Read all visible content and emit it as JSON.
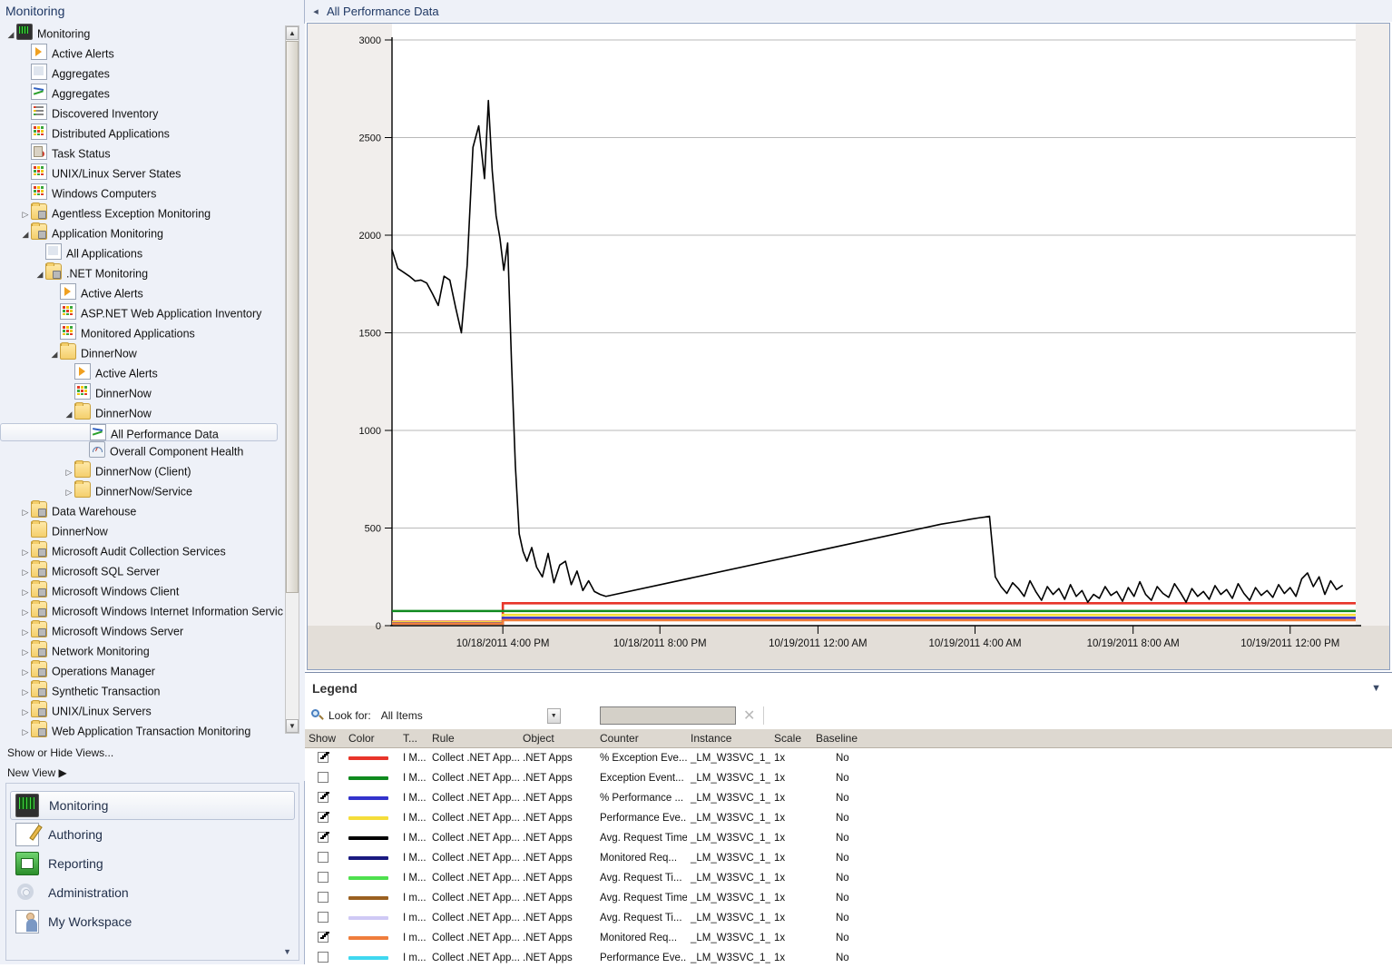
{
  "nav": {
    "header_title": "Monitoring",
    "collapse_icon": "chevron-left-icon",
    "tree": [
      {
        "depth": 0,
        "expander": "expanded",
        "icon": "monitor-icon",
        "label": "Monitoring"
      },
      {
        "depth": 1,
        "expander": "none",
        "icon": "alert-icon",
        "label": "Active Alerts"
      },
      {
        "depth": 1,
        "expander": "none",
        "icon": "report-icon",
        "label": "Aggregates"
      },
      {
        "depth": 1,
        "expander": "none",
        "icon": "chart-icon",
        "label": "Aggregates"
      },
      {
        "depth": 1,
        "expander": "none",
        "icon": "list-icon",
        "label": "Discovered Inventory"
      },
      {
        "depth": 1,
        "expander": "none",
        "icon": "grid-icon",
        "label": "Distributed Applications"
      },
      {
        "depth": 1,
        "expander": "none",
        "icon": "task-icon",
        "label": "Task Status"
      },
      {
        "depth": 1,
        "expander": "none",
        "icon": "grid-icon",
        "label": "UNIX/Linux Server States"
      },
      {
        "depth": 1,
        "expander": "none",
        "icon": "grid-icon",
        "label": "Windows Computers"
      },
      {
        "depth": 1,
        "expander": "collapsed",
        "icon": "folder-lock-icon",
        "label": "Agentless Exception Monitoring"
      },
      {
        "depth": 1,
        "expander": "expanded",
        "icon": "folder-lock-icon",
        "label": "Application Monitoring"
      },
      {
        "depth": 2,
        "expander": "none",
        "icon": "report-icon",
        "label": "All Applications"
      },
      {
        "depth": 2,
        "expander": "expanded",
        "icon": "folder-lock-icon",
        "label": ".NET Monitoring"
      },
      {
        "depth": 3,
        "expander": "none",
        "icon": "alert-icon",
        "label": "Active Alerts"
      },
      {
        "depth": 3,
        "expander": "none",
        "icon": "grid-icon",
        "label": "ASP.NET Web Application Inventory"
      },
      {
        "depth": 3,
        "expander": "none",
        "icon": "grid-icon",
        "label": "Monitored Applications"
      },
      {
        "depth": 3,
        "expander": "expanded",
        "icon": "folder-icon",
        "label": "DinnerNow"
      },
      {
        "depth": 4,
        "expander": "none",
        "icon": "alert-icon",
        "label": "Active Alerts"
      },
      {
        "depth": 4,
        "expander": "none",
        "icon": "grid-icon",
        "label": "DinnerNow"
      },
      {
        "depth": 4,
        "expander": "expanded",
        "icon": "folder-icon",
        "label": "DinnerNow"
      },
      {
        "depth": 5,
        "expander": "none",
        "icon": "chart-icon",
        "label": "All Performance Data",
        "selected": true
      },
      {
        "depth": 5,
        "expander": "none",
        "icon": "gauge-icon",
        "label": "Overall Component Health"
      },
      {
        "depth": 4,
        "expander": "collapsed",
        "icon": "folder-icon",
        "label": "DinnerNow (Client)"
      },
      {
        "depth": 4,
        "expander": "collapsed",
        "icon": "folder-icon",
        "label": "DinnerNow/Service"
      },
      {
        "depth": 1,
        "expander": "collapsed",
        "icon": "folder-lock-icon",
        "label": "Data Warehouse"
      },
      {
        "depth": 1,
        "expander": "none",
        "icon": "folder-icon",
        "label": "DinnerNow"
      },
      {
        "depth": 1,
        "expander": "collapsed",
        "icon": "folder-lock-icon",
        "label": "Microsoft Audit Collection Services"
      },
      {
        "depth": 1,
        "expander": "collapsed",
        "icon": "folder-lock-icon",
        "label": "Microsoft SQL Server"
      },
      {
        "depth": 1,
        "expander": "collapsed",
        "icon": "folder-lock-icon",
        "label": "Microsoft Windows Client"
      },
      {
        "depth": 1,
        "expander": "collapsed",
        "icon": "folder-lock-icon",
        "label": "Microsoft Windows Internet Information Services"
      },
      {
        "depth": 1,
        "expander": "collapsed",
        "icon": "folder-lock-icon",
        "label": "Microsoft Windows Server"
      },
      {
        "depth": 1,
        "expander": "collapsed",
        "icon": "folder-lock-icon",
        "label": "Network Monitoring"
      },
      {
        "depth": 1,
        "expander": "collapsed",
        "icon": "folder-lock-icon",
        "label": "Operations Manager"
      },
      {
        "depth": 1,
        "expander": "collapsed",
        "icon": "folder-lock-icon",
        "label": "Synthetic Transaction"
      },
      {
        "depth": 1,
        "expander": "collapsed",
        "icon": "folder-lock-icon",
        "label": "UNIX/Linux Servers"
      },
      {
        "depth": 1,
        "expander": "collapsed",
        "icon": "folder-lock-icon",
        "label": "Web Application Transaction Monitoring"
      }
    ],
    "links": [
      {
        "label": "Show or Hide Views..."
      },
      {
        "label": "New View ▶"
      }
    ],
    "buttons": [
      {
        "label": "Monitoring",
        "icon": "monitoring-icon",
        "active": true
      },
      {
        "label": "Authoring",
        "icon": "authoring-icon",
        "active": false
      },
      {
        "label": "Reporting",
        "icon": "reporting-icon",
        "active": false
      },
      {
        "label": "Administration",
        "icon": "administration-icon",
        "active": false
      },
      {
        "label": "My Workspace",
        "icon": "my-workspace-icon",
        "active": false
      }
    ],
    "more_icon": "chevron-down-icon"
  },
  "main": {
    "collapse_icon": "chevron-left-icon",
    "title": "All Performance Data"
  },
  "legend": {
    "title": "Legend",
    "collapse_icon": "chevron-down-icon",
    "search_icon": "search-icon",
    "lookfor_label": "Look for:",
    "lookfor_value": "All Items",
    "lookfor_arrow": "chevron-down-icon",
    "search_value": "",
    "search_placeholder": "",
    "clear_icon": "close-icon",
    "columns": [
      "Show",
      "Color",
      "T...",
      "Rule",
      "Object",
      "Counter",
      "Instance",
      "Scale",
      "Baseline"
    ],
    "rows": [
      {
        "show": true,
        "color": "#e8352a",
        "type": "I M...",
        "rule": "Collect .NET App...",
        "object": ".NET Apps",
        "counter": "% Exception Eve...",
        "instance": "_LM_W3SVC_1_...",
        "scale": "1x",
        "baseline": "No"
      },
      {
        "show": false,
        "color": "#0f8a1e",
        "type": "I M...",
        "rule": "Collect .NET App...",
        "object": ".NET Apps",
        "counter": "Exception Event...",
        "instance": "_LM_W3SVC_1_...",
        "scale": "1x",
        "baseline": "No"
      },
      {
        "show": true,
        "color": "#3333cc",
        "type": "I M...",
        "rule": "Collect .NET App...",
        "object": ".NET Apps",
        "counter": "% Performance ...",
        "instance": "_LM_W3SVC_1_...",
        "scale": "1x",
        "baseline": "No"
      },
      {
        "show": true,
        "color": "#f5dd3a",
        "type": "I M...",
        "rule": "Collect .NET App...",
        "object": ".NET Apps",
        "counter": "Performance Eve...",
        "instance": "_LM_W3SVC_1_...",
        "scale": "1x",
        "baseline": "No"
      },
      {
        "show": true,
        "color": "#000000",
        "type": "I M...",
        "rule": "Collect .NET App...",
        "object": ".NET Apps",
        "counter": "Avg. Request Time",
        "instance": "_LM_W3SVC_1_...",
        "scale": "1x",
        "baseline": "No"
      },
      {
        "show": false,
        "color": "#1a1a80",
        "type": "I M...",
        "rule": "Collect .NET App...",
        "object": ".NET Apps",
        "counter": "Monitored Req...",
        "instance": "_LM_W3SVC_1_...",
        "scale": "1x",
        "baseline": "No"
      },
      {
        "show": false,
        "color": "#4ee04e",
        "type": "I M...",
        "rule": "Collect .NET App...",
        "object": ".NET Apps",
        "counter": "Avg. Request Ti...",
        "instance": "_LM_W3SVC_1_...",
        "scale": "1x",
        "baseline": "No"
      },
      {
        "show": false,
        "color": "#9a6020",
        "type": "I m...",
        "rule": "Collect .NET App...",
        "object": ".NET Apps",
        "counter": "Avg. Request Time",
        "instance": "_LM_W3SVC_1_...",
        "scale": "1x",
        "baseline": "No"
      },
      {
        "show": false,
        "color": "#cfc9f5",
        "type": "I m...",
        "rule": "Collect .NET App...",
        "object": ".NET Apps",
        "counter": "Avg. Request Ti...",
        "instance": "_LM_W3SVC_1_...",
        "scale": "1x",
        "baseline": "No"
      },
      {
        "show": true,
        "color": "#ef7d3c",
        "type": "I m...",
        "rule": "Collect .NET App...",
        "object": ".NET Apps",
        "counter": "Monitored Req...",
        "instance": "_LM_W3SVC_1_...",
        "scale": "1x",
        "baseline": "No"
      },
      {
        "show": false,
        "color": "#3fd8f0",
        "type": "I m...",
        "rule": "Collect .NET App...",
        "object": ".NET Apps",
        "counter": "Performance Eve...",
        "instance": "_LM_W3SVC_1_...",
        "scale": "1x",
        "baseline": "No"
      }
    ]
  },
  "chart_data": {
    "type": "line",
    "title": "",
    "xlabel": "",
    "ylabel": "",
    "ylim": [
      0,
      3000
    ],
    "yticks": [
      0,
      500,
      1000,
      1500,
      2000,
      2500,
      3000
    ],
    "grid": true,
    "legend_position": "below",
    "xticks": [
      "10/18/2011 4:00 PM",
      "10/18/2011 8:00 PM",
      "10/19/2011 12:00 AM",
      "10/19/2011 4:00 AM",
      "10/19/2011 8:00 AM",
      "10/19/2011 12:00 PM"
    ],
    "xtick_positions": [
      0.115,
      0.278,
      0.442,
      0.605,
      0.769,
      0.932
    ],
    "series": [
      {
        "name": "Avg. Request Time",
        "color": "#000000",
        "x": [
          0.0,
          0.006,
          0.012,
          0.018,
          0.024,
          0.03,
          0.036,
          0.042,
          0.048,
          0.054,
          0.06,
          0.066,
          0.072,
          0.078,
          0.084,
          0.09,
          0.096,
          0.1,
          0.104,
          0.108,
          0.112,
          0.116,
          0.12,
          0.124,
          0.128,
          0.132,
          0.136,
          0.14,
          0.145,
          0.15,
          0.156,
          0.162,
          0.168,
          0.174,
          0.18,
          0.186,
          0.192,
          0.198,
          0.204,
          0.21,
          0.216,
          0.222,
          0.57,
          0.58,
          0.59,
          0.6,
          0.61,
          0.615,
          0.62,
          0.626,
          0.632,
          0.638,
          0.644,
          0.65,
          0.656,
          0.662,
          0.668,
          0.674,
          0.68,
          0.686,
          0.692,
          0.698,
          0.704,
          0.71,
          0.716,
          0.722,
          0.728,
          0.734,
          0.74,
          0.746,
          0.752,
          0.758,
          0.764,
          0.77,
          0.776,
          0.782,
          0.788,
          0.794,
          0.8,
          0.806,
          0.812,
          0.818,
          0.824,
          0.83,
          0.836,
          0.842,
          0.848,
          0.854,
          0.86,
          0.866,
          0.872,
          0.878,
          0.884,
          0.89,
          0.896,
          0.902,
          0.908,
          0.914,
          0.92,
          0.926,
          0.932,
          0.938,
          0.944,
          0.95,
          0.956,
          0.962,
          0.968,
          0.974,
          0.98,
          0.986,
          0.992,
          0.998
        ],
        "y": [
          1925,
          1830,
          1810,
          1790,
          1765,
          1770,
          1755,
          1700,
          1640,
          1790,
          1770,
          1630,
          1500,
          1845,
          2450,
          2560,
          2290,
          2690,
          2330,
          2100,
          1985,
          1820,
          1960,
          1350,
          820,
          470,
          380,
          330,
          400,
          300,
          250,
          370,
          220,
          310,
          330,
          210,
          280,
          180,
          230,
          175,
          160,
          150,
          520,
          528,
          536,
          545,
          553,
          556,
          560,
          250,
          200,
          165,
          220,
          190,
          150,
          230,
          175,
          130,
          200,
          160,
          190,
          135,
          210,
          150,
          180,
          120,
          160,
          140,
          200,
          155,
          175,
          125,
          195,
          150,
          225,
          160,
          130,
          200,
          165,
          145,
          215,
          170,
          120,
          190,
          150,
          175,
          135,
          205,
          160,
          185,
          140,
          215,
          165,
          130,
          195,
          155,
          180,
          145,
          210,
          165,
          195,
          150,
          240,
          270,
          200,
          250,
          160,
          230,
          185,
          205
        ],
        "note": "Avg. Request Time — black solid line; spikes up to ~2690 early, drops, then a slow linear rise to ~560 around 10/19 8:00 AM, then collapse to noisy 120-270 band"
      },
      {
        "name": "% Exception Events",
        "color": "#e8352a",
        "flat_level": 115,
        "step_at": 0.115,
        "pre_level": 20,
        "note": "red line near bottom, steps up at 10/18 4:00 PM"
      },
      {
        "name": "Performance Events",
        "color": "#f5dd3a",
        "flat_level": 55,
        "step_at": 0.115,
        "pre_level": 18,
        "note": "yellow line near bottom"
      },
      {
        "name": "% Performance Events",
        "color": "#3333cc",
        "flat_level": 40,
        "step_at": 0.115,
        "pre_level": 12,
        "note": "blue line near bottom"
      },
      {
        "name": "Monitored Requests",
        "color": "#ef7d3c",
        "flat_level": 28,
        "step_at": 0.115,
        "pre_level": 10,
        "note": "orange line near bottom"
      },
      {
        "name": "Exception Events",
        "color": "#0f8a1e",
        "flat_level": 75,
        "step_at": 0.0,
        "pre_level": 75,
        "note": "green line near bottom"
      }
    ]
  }
}
